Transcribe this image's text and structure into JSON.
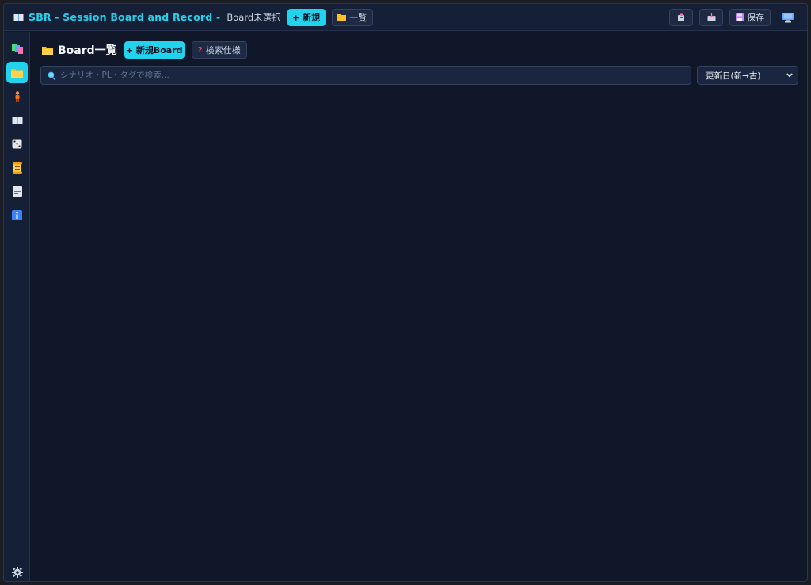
{
  "topbar": {
    "app_title": "SBR - Session Board and Record -",
    "board_status": "Board未選択",
    "new_label": "+ 新規",
    "list_label": "一覧",
    "save_label": "保存",
    "icons": {
      "app": "book-icon",
      "list": "folder-icon",
      "export": "clipboard-export-icon",
      "import": "inbox-import-icon",
      "save": "floppy-disk-icon",
      "display": "monitor-icon"
    }
  },
  "sidebar": {
    "items": [
      {
        "name": "boards-icon",
        "glyph": "▚",
        "active": false
      },
      {
        "name": "folder-icon",
        "glyph": "▭",
        "active": true
      },
      {
        "name": "person-icon",
        "glyph": "▮",
        "active": false
      },
      {
        "name": "book-icon",
        "glyph": "▬",
        "active": false
      },
      {
        "name": "dice-icon",
        "glyph": "⚅",
        "active": false
      },
      {
        "name": "scroll-icon",
        "glyph": "▤",
        "active": false
      },
      {
        "name": "memo-icon",
        "glyph": "▦",
        "active": false
      },
      {
        "name": "info-icon",
        "glyph": "i",
        "active": false
      }
    ],
    "settings_icon": "gear-icon"
  },
  "main": {
    "title": "Board一覧",
    "new_board_label": "+ 新規Board",
    "search_spec_label": "検索仕様",
    "search_placeholder": "シナリオ・PL・タグで検索...",
    "sort": {
      "selected": "更新日(新→古)"
    }
  },
  "colors": {
    "accent": "#22d3ee",
    "background": "#0f1729",
    "panel": "#151f36"
  }
}
